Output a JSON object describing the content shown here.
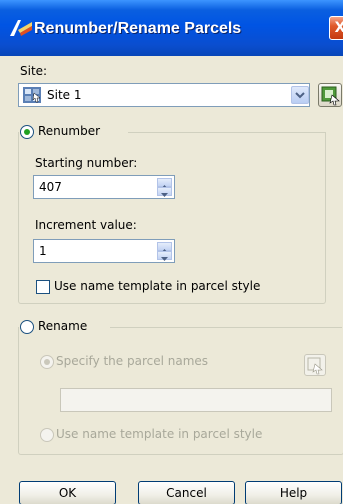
{
  "dialog": {
    "title": "Renumber/Rename Parcels",
    "close_glyph": "X"
  },
  "site": {
    "label": "Site:",
    "selected": "Site 1",
    "icon": "site-icon",
    "pick_icon": "pick-from-drawing-icon"
  },
  "renumber": {
    "label": "Renumber",
    "selected": true,
    "starting_number_label": "Starting number:",
    "starting_number": "407",
    "increment_label": "Increment value:",
    "increment": "1",
    "use_template_label": "Use name template in parcel style",
    "use_template_checked": false
  },
  "rename": {
    "label": "Rename",
    "selected": false,
    "specify_names_label": "Specify the parcel names",
    "names_value": "",
    "use_template_label": "Use name template in parcel style"
  },
  "buttons": {
    "ok": "OK",
    "cancel": "Cancel",
    "help": "Help"
  }
}
